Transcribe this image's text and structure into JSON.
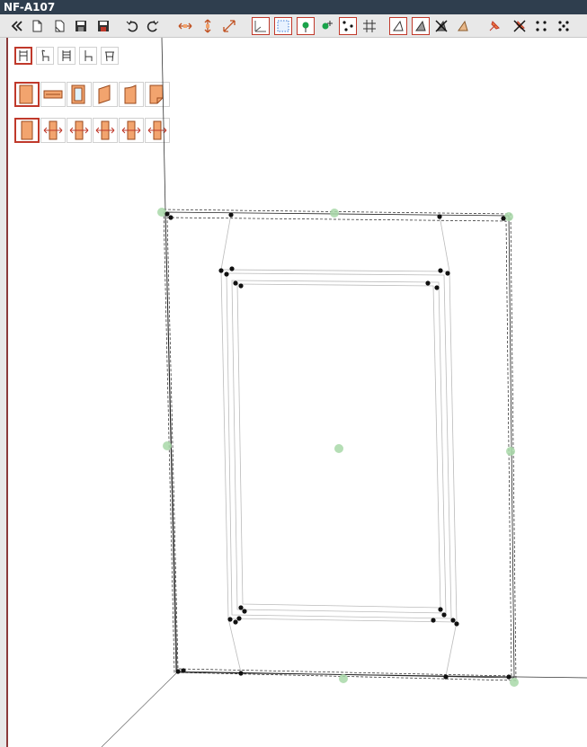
{
  "window": {
    "title": "NF-A107"
  },
  "toolbar": {
    "buttons": [
      {
        "name": "collapse-button",
        "icon": "double-chevron-left-icon",
        "active": false
      },
      {
        "name": "new-document-button",
        "icon": "blank-page-icon",
        "active": false
      },
      {
        "name": "open-document-button",
        "icon": "folded-page-icon",
        "active": false
      },
      {
        "name": "save-button",
        "icon": "floppy-disk-icon",
        "active": false
      },
      {
        "name": "save-as-button",
        "icon": "floppy-disk-red-icon",
        "active": false
      },
      {
        "name": "undo-button",
        "icon": "undo-icon",
        "active": false
      },
      {
        "name": "redo-button",
        "icon": "redo-icon",
        "active": false
      },
      {
        "name": "horizontal-resize-button",
        "icon": "horizontal-arrows-icon",
        "active": false
      },
      {
        "name": "vertical-resize-button",
        "icon": "vertical-arrows-icon",
        "active": false
      },
      {
        "name": "diagonal-resize-button",
        "icon": "diagonal-arrows-icon",
        "active": false
      },
      {
        "name": "axis-view-button",
        "icon": "axis-corner-icon",
        "active": true
      },
      {
        "name": "bounding-box-button",
        "icon": "dotted-box-icon",
        "active": true
      },
      {
        "name": "pin-point-button",
        "icon": "green-pin-icon",
        "active": true
      },
      {
        "name": "pin-plus-button",
        "icon": "green-pin-plus-icon",
        "active": false
      },
      {
        "name": "dots-view-button",
        "icon": "three-dots-icon",
        "active": true
      },
      {
        "name": "grid-snap-button",
        "icon": "hash-grid-icon",
        "active": false
      },
      {
        "name": "outline-cone-button",
        "icon": "cone-outline-icon",
        "active": true
      },
      {
        "name": "shaded-cone-button",
        "icon": "cone-shaded-icon",
        "active": true
      },
      {
        "name": "cross-cone-button",
        "icon": "cone-cross-icon",
        "active": false
      },
      {
        "name": "textured-cone-button",
        "icon": "cone-textured-icon",
        "active": false
      },
      {
        "name": "orange-pin-button",
        "icon": "orange-pin-icon",
        "active": false
      },
      {
        "name": "orange-pin-cross-button",
        "icon": "orange-pin-cross-icon",
        "active": false
      },
      {
        "name": "four-dots-button",
        "icon": "four-dots-icon",
        "active": false
      },
      {
        "name": "five-dots-button",
        "icon": "five-dots-icon",
        "active": false
      }
    ]
  },
  "furniture_panel": {
    "chair_buttons": [
      {
        "name": "chair-front-button",
        "icon": "chair-front-icon",
        "active": true
      },
      {
        "name": "chair-side-button",
        "icon": "chair-side-icon",
        "active": false
      },
      {
        "name": "chair-back-button",
        "icon": "chair-back-icon",
        "active": false
      },
      {
        "name": "chair-profile-button",
        "icon": "chair-profile-icon",
        "active": false
      },
      {
        "name": "stool-button",
        "icon": "stool-icon",
        "active": false
      }
    ],
    "panel_buttons": [
      {
        "name": "panel-solid-button",
        "icon": "panel-solid-icon",
        "active": true
      },
      {
        "name": "panel-rail-button",
        "icon": "panel-rail-icon",
        "active": false
      },
      {
        "name": "panel-glass-button",
        "icon": "panel-glass-icon",
        "active": false
      },
      {
        "name": "panel-skew-button",
        "icon": "panel-skew-icon",
        "active": false
      },
      {
        "name": "panel-curve-button",
        "icon": "panel-curve-icon",
        "active": false
      },
      {
        "name": "panel-fold-button",
        "icon": "panel-fold-icon",
        "active": false
      }
    ],
    "stile_buttons": [
      {
        "name": "stile-plain-button",
        "icon": "stile-plain-icon",
        "active": true
      },
      {
        "name": "stile-arrows-1-button",
        "icon": "stile-arrows-icon",
        "active": false
      },
      {
        "name": "stile-arrows-2-button",
        "icon": "stile-arrows-icon",
        "active": false
      },
      {
        "name": "stile-arrows-3-button",
        "icon": "stile-arrows-icon",
        "active": false
      },
      {
        "name": "stile-arrows-4-button",
        "icon": "stile-arrows-icon",
        "active": false
      },
      {
        "name": "stile-arrows-5-button",
        "icon": "stile-arrows-icon",
        "active": false
      }
    ]
  },
  "colors": {
    "title_bg": "#2f3e4e",
    "active_border": "#c0392b",
    "panel_fill": "#f2a46e",
    "panel_stroke": "#9a4a1e",
    "handle_green": "#a8d8a8"
  }
}
